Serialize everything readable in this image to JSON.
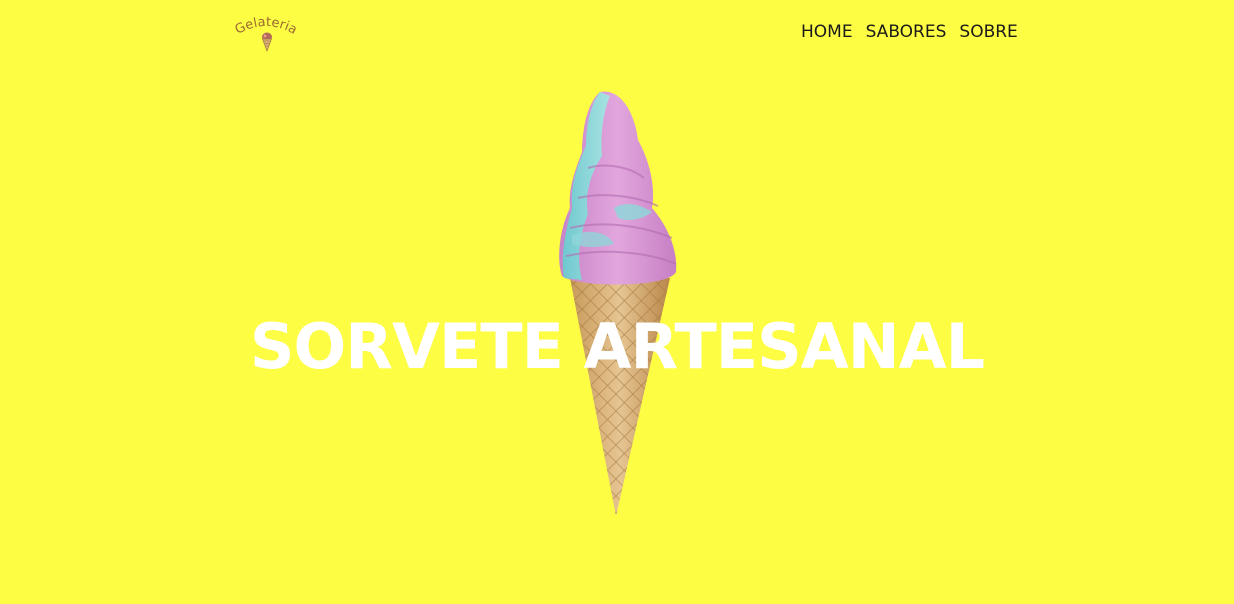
{
  "brand": {
    "logo_text": "Gelateria"
  },
  "nav": {
    "items": [
      {
        "label": "HOME"
      },
      {
        "label": "SABORES"
      },
      {
        "label": "SOBRE"
      }
    ]
  },
  "hero": {
    "title": "SORVETE ARTESANAL",
    "image": "soft-serve-ice-cream-cone"
  },
  "colors": {
    "background": "#fdfd44",
    "title": "#ffffff",
    "nav_text": "#1a1a1a",
    "logo": "#8a5a2b"
  }
}
